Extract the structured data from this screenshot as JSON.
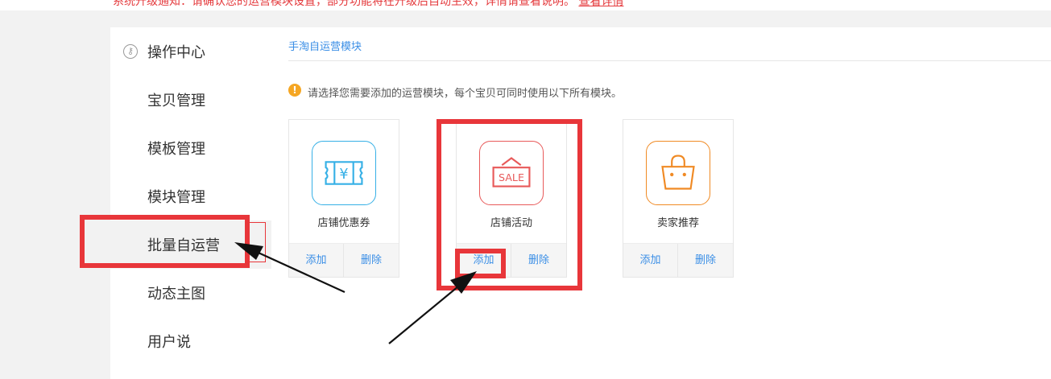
{
  "notice": {
    "text": "系统升级通知：请确认您的运营模块设置，部分功能将在升级后自动生效，详情请查看说明。",
    "link_label": "查看详情"
  },
  "sidebar": {
    "items": [
      {
        "label": "操作中心",
        "icon": "key-icon"
      },
      {
        "label": "宝贝管理"
      },
      {
        "label": "模板管理"
      },
      {
        "label": "模块管理"
      },
      {
        "label": "批量自运营",
        "active": true
      },
      {
        "label": "动态主图"
      },
      {
        "label": "用户说"
      }
    ]
  },
  "main": {
    "breadcrumb": "手淘自运营模块",
    "tip": "请选择您需要添加的运营模块，每个宝贝可同时使用以下所有模块。",
    "modules": [
      {
        "name": "店铺优惠券",
        "icon": "coupon-icon",
        "icon_glyph": "¥",
        "color": "#36b0e6",
        "add_label": "添加",
        "delete_label": "删除"
      },
      {
        "name": "店铺活动",
        "icon": "sale-sign-icon",
        "icon_glyph": "SALE",
        "color": "#e85a5a",
        "add_label": "添加",
        "delete_label": "删除"
      },
      {
        "name": "卖家推荐",
        "icon": "shopping-bag-icon",
        "color": "#f08a24",
        "add_label": "添加",
        "delete_label": "删除"
      }
    ]
  },
  "annotation_color": "#e8363a"
}
